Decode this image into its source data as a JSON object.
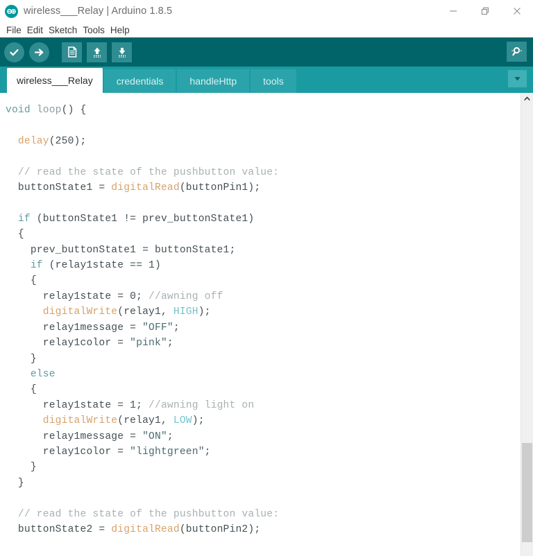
{
  "window": {
    "title": "wireless___Relay | Arduino 1.8.5",
    "logo_icon": "arduino-infinity-logo",
    "controls": [
      {
        "name": "minimize",
        "icon": "minimize-icon"
      },
      {
        "name": "restore",
        "icon": "restore-icon"
      },
      {
        "name": "close",
        "icon": "close-icon"
      }
    ]
  },
  "menubar": {
    "items": [
      {
        "label": "File"
      },
      {
        "label": "Edit"
      },
      {
        "label": "Sketch"
      },
      {
        "label": "Tools"
      },
      {
        "label": "Help"
      }
    ]
  },
  "toolbar": {
    "buttons": [
      {
        "name": "verify",
        "label": "Verify",
        "icon": "checkmark-icon"
      },
      {
        "name": "upload",
        "label": "Upload",
        "icon": "arrow-right-icon"
      },
      {
        "name": "new",
        "label": "New",
        "icon": "document-icon"
      },
      {
        "name": "open",
        "label": "Open",
        "icon": "arrow-up-icon"
      },
      {
        "name": "save",
        "label": "Save",
        "icon": "arrow-down-icon"
      }
    ],
    "serial_monitor": {
      "name": "serial-monitor",
      "label": "Serial Monitor",
      "icon": "magnifier-icon"
    },
    "background_color": "#006468",
    "button_color": "#2f8c90"
  },
  "tabbar": {
    "background_color": "#1a9ba1",
    "tabs": [
      {
        "label": "wireless___Relay",
        "active": true
      },
      {
        "label": "credentials",
        "active": false
      },
      {
        "label": "handleHttp",
        "active": false
      },
      {
        "label": "tools",
        "active": false
      }
    ],
    "menu_button": {
      "name": "tab-menu",
      "icon": "chevron-down-icon"
    }
  },
  "editor": {
    "language": "arduino-cpp",
    "colors": {
      "keyword": "#5e9ca0",
      "function": "#d7a16a",
      "constant": "#73c3c9",
      "comment": "#a8b0b2",
      "string": "#4a6a70",
      "plain": "#434f54"
    },
    "lines": [
      [
        {
          "t": "void",
          "c": "k-kw"
        },
        {
          "t": " ",
          "c": "k-plain"
        },
        {
          "t": "loop",
          "c": "k-fn"
        },
        {
          "t": "() {",
          "c": "k-plain"
        }
      ],
      [],
      [
        {
          "t": "  ",
          "c": "k-plain"
        },
        {
          "t": "delay",
          "c": "k-func"
        },
        {
          "t": "(250);",
          "c": "k-plain"
        }
      ],
      [],
      [
        {
          "t": "  ",
          "c": "k-plain"
        },
        {
          "t": "// read the state of the pushbutton value:",
          "c": "k-comment"
        }
      ],
      [
        {
          "t": "  buttonState1 = ",
          "c": "k-plain"
        },
        {
          "t": "digitalRead",
          "c": "k-func"
        },
        {
          "t": "(buttonPin1);",
          "c": "k-plain"
        }
      ],
      [],
      [
        {
          "t": "  ",
          "c": "k-plain"
        },
        {
          "t": "if",
          "c": "k-kw"
        },
        {
          "t": " (buttonState1 != prev_buttonState1)",
          "c": "k-plain"
        }
      ],
      [
        {
          "t": "  {",
          "c": "k-plain"
        }
      ],
      [
        {
          "t": "    prev_buttonState1 = buttonState1;",
          "c": "k-plain"
        }
      ],
      [
        {
          "t": "    ",
          "c": "k-plain"
        },
        {
          "t": "if",
          "c": "k-kw"
        },
        {
          "t": " (relay1state == 1)",
          "c": "k-plain"
        }
      ],
      [
        {
          "t": "    {",
          "c": "k-plain"
        }
      ],
      [
        {
          "t": "      relay1state = 0; ",
          "c": "k-plain"
        },
        {
          "t": "//awning off",
          "c": "k-comment"
        }
      ],
      [
        {
          "t": "      ",
          "c": "k-plain"
        },
        {
          "t": "digitalWrite",
          "c": "k-func"
        },
        {
          "t": "(relay1, ",
          "c": "k-plain"
        },
        {
          "t": "HIGH",
          "c": "k-const"
        },
        {
          "t": ");",
          "c": "k-plain"
        }
      ],
      [
        {
          "t": "      relay1message = ",
          "c": "k-plain"
        },
        {
          "t": "\"OFF\"",
          "c": "k-str"
        },
        {
          "t": ";",
          "c": "k-plain"
        }
      ],
      [
        {
          "t": "      relay1color = ",
          "c": "k-plain"
        },
        {
          "t": "\"pink\"",
          "c": "k-str"
        },
        {
          "t": ";",
          "c": "k-plain"
        }
      ],
      [
        {
          "t": "    }",
          "c": "k-plain"
        }
      ],
      [
        {
          "t": "    ",
          "c": "k-plain"
        },
        {
          "t": "else",
          "c": "k-kw"
        }
      ],
      [
        {
          "t": "    {",
          "c": "k-plain"
        }
      ],
      [
        {
          "t": "      relay1state = 1; ",
          "c": "k-plain"
        },
        {
          "t": "//awning light on",
          "c": "k-comment"
        }
      ],
      [
        {
          "t": "      ",
          "c": "k-plain"
        },
        {
          "t": "digitalWrite",
          "c": "k-func"
        },
        {
          "t": "(relay1, ",
          "c": "k-plain"
        },
        {
          "t": "LOW",
          "c": "k-const"
        },
        {
          "t": ");",
          "c": "k-plain"
        }
      ],
      [
        {
          "t": "      relay1message = ",
          "c": "k-plain"
        },
        {
          "t": "\"ON\"",
          "c": "k-str"
        },
        {
          "t": ";",
          "c": "k-plain"
        }
      ],
      [
        {
          "t": "      relay1color = ",
          "c": "k-plain"
        },
        {
          "t": "\"lightgreen\"",
          "c": "k-str"
        },
        {
          "t": ";",
          "c": "k-plain"
        }
      ],
      [
        {
          "t": "    }",
          "c": "k-plain"
        }
      ],
      [
        {
          "t": "  }",
          "c": "k-plain"
        }
      ],
      [],
      [
        {
          "t": "  ",
          "c": "k-plain"
        },
        {
          "t": "// read the state of the pushbutton value:",
          "c": "k-comment"
        }
      ],
      [
        {
          "t": "  buttonState2 = ",
          "c": "k-plain"
        },
        {
          "t": "digitalRead",
          "c": "k-func"
        },
        {
          "t": "(buttonPin2);",
          "c": "k-plain"
        }
      ]
    ]
  },
  "scrollbar": {
    "name": "vertical-scrollbar",
    "up_arrow_icon": "chevron-up-icon",
    "thumb_top_percent": 75,
    "thumb_height_percent": 22
  }
}
